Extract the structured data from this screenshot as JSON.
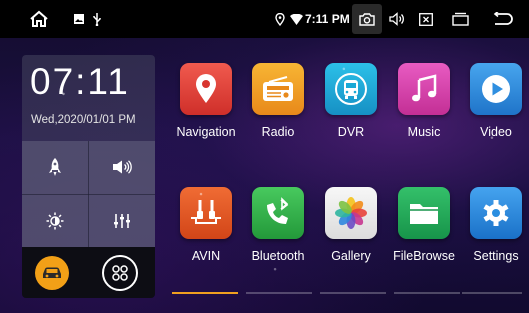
{
  "status_bar": {
    "time": "7:11 PM",
    "icons": [
      "home-icon",
      "gallery-icon",
      "usb-icon",
      "location-icon",
      "wifi-icon",
      "camera-icon",
      "volume-icon",
      "close-box-icon",
      "recent-apps-icon",
      "back-icon"
    ]
  },
  "clock": {
    "time": "07:11",
    "date": "Wed,2020/01/01 PM"
  },
  "quick_controls": [
    {
      "icon": "rocket-icon"
    },
    {
      "icon": "speaker-icon"
    },
    {
      "icon": "brightness-icon"
    },
    {
      "icon": "equalizer-icon"
    }
  ],
  "shortcuts": [
    {
      "icon": "car-icon"
    },
    {
      "icon": "apps-grid-icon"
    }
  ],
  "apps": [
    {
      "label": "Navigation",
      "icon": "map-pin-icon",
      "color": "#e8433d"
    },
    {
      "label": "Radio",
      "icon": "radio-icon",
      "color": "#f3a21c"
    },
    {
      "label": "DVR",
      "icon": "bus-icon",
      "color": "#1aa9d6"
    },
    {
      "label": "Music",
      "icon": "music-note-icon",
      "color": "#d93ca9"
    },
    {
      "label": "Video",
      "icon": "play-icon",
      "color": "#2f8fe0"
    },
    {
      "label": "AVIN",
      "icon": "av-input-icon",
      "color": "#e55722"
    },
    {
      "label": "Bluetooth",
      "icon": "bluetooth-phone-icon",
      "color": "#33b44a"
    },
    {
      "label": "Gallery",
      "icon": "flower-icon",
      "color": "#eaeaea"
    },
    {
      "label": "FileBrowse",
      "icon": "folder-icon",
      "color": "#22a85a"
    },
    {
      "label": "Settings",
      "icon": "gear-icon",
      "color": "#2a8ee0"
    }
  ],
  "pager": {
    "pages": 5,
    "active": 1
  }
}
